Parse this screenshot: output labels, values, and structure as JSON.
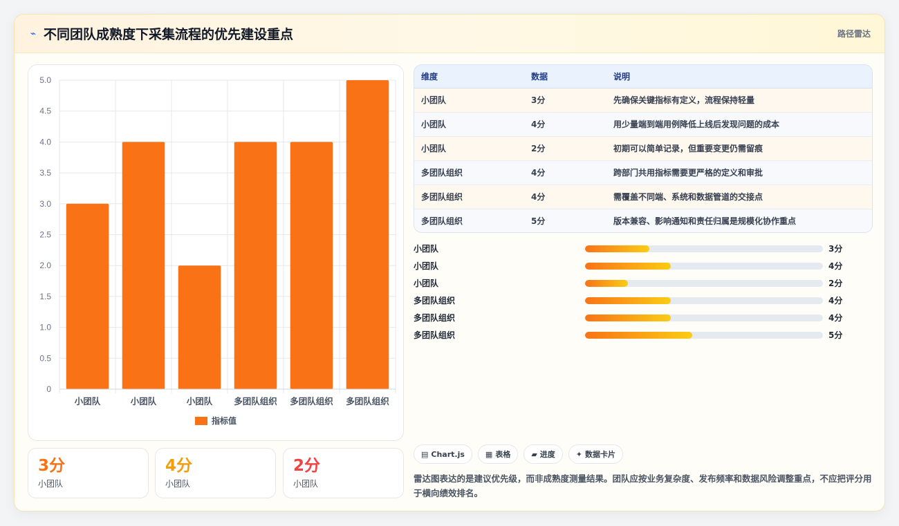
{
  "header": {
    "title": "不同团队成熟度下采集流程的优先建设重点",
    "tag": "路径雷达"
  },
  "chart_data": {
    "type": "bar",
    "categories": [
      "小团队",
      "小团队",
      "小团队",
      "多团队组织",
      "多团队组织",
      "多团队组织"
    ],
    "series": [
      {
        "name": "指标值",
        "values": [
          3,
          4,
          2,
          4,
          4,
          5
        ],
        "color": "#f97316"
      }
    ],
    "yticks": [
      "0",
      "0.5",
      "1.0",
      "1.5",
      "2.0",
      "2.5",
      "3.0",
      "3.5",
      "4.0",
      "4.5",
      "5.0"
    ],
    "ylim": [
      0,
      5
    ],
    "grid": true,
    "legend_position": "bottom"
  },
  "stats": [
    {
      "value": "3分",
      "label": "小团队",
      "color": "#f97316"
    },
    {
      "value": "4分",
      "label": "小团队",
      "color": "#f59e0b"
    },
    {
      "value": "2分",
      "label": "小团队",
      "color": "#ef4444"
    }
  ],
  "table": {
    "headers": [
      "维度",
      "数据",
      "说明"
    ],
    "rows": [
      [
        "小团队",
        "3分",
        "先确保关键指标有定义，流程保持轻量"
      ],
      [
        "小团队",
        "4分",
        "用少量端到端用例降低上线后发现问题的成本"
      ],
      [
        "小团队",
        "2分",
        "初期可以简单记录，但重要变更仍需留痕"
      ],
      [
        "多团队组织",
        "4分",
        "跨部门共用指标需要更严格的定义和审批"
      ],
      [
        "多团队组织",
        "4分",
        "需覆盖不同端、系统和数据管道的交接点"
      ],
      [
        "多团队组织",
        "5分",
        "版本兼容、影响通知和责任归属是规模化协作重点"
      ]
    ]
  },
  "progress": [
    {
      "name": "小团队",
      "score": "3分",
      "fraction": 0.27
    },
    {
      "name": "小团队",
      "score": "4分",
      "fraction": 0.36
    },
    {
      "name": "小团队",
      "score": "2分",
      "fraction": 0.18
    },
    {
      "name": "多团队组织",
      "score": "4分",
      "fraction": 0.36
    },
    {
      "name": "多团队组织",
      "score": "4分",
      "fraction": 0.36
    },
    {
      "name": "多团队组织",
      "score": "5分",
      "fraction": 0.45
    }
  ],
  "chips": [
    {
      "icon": "▤",
      "icon_name": "chart-icon",
      "label": "Chart.js"
    },
    {
      "icon": "▦",
      "icon_name": "table-icon",
      "label": "表格"
    },
    {
      "icon": "▰",
      "icon_name": "progress-icon",
      "label": "进度"
    },
    {
      "icon": "✦",
      "icon_name": "card-icon",
      "label": "数据卡片"
    }
  ],
  "note": "雷达图表达的是建议优先级，而非成熟度测量结果。团队应按业务复杂度、发布频率和数据风险调整重点，不应把评分用于横向绩效排名。"
}
